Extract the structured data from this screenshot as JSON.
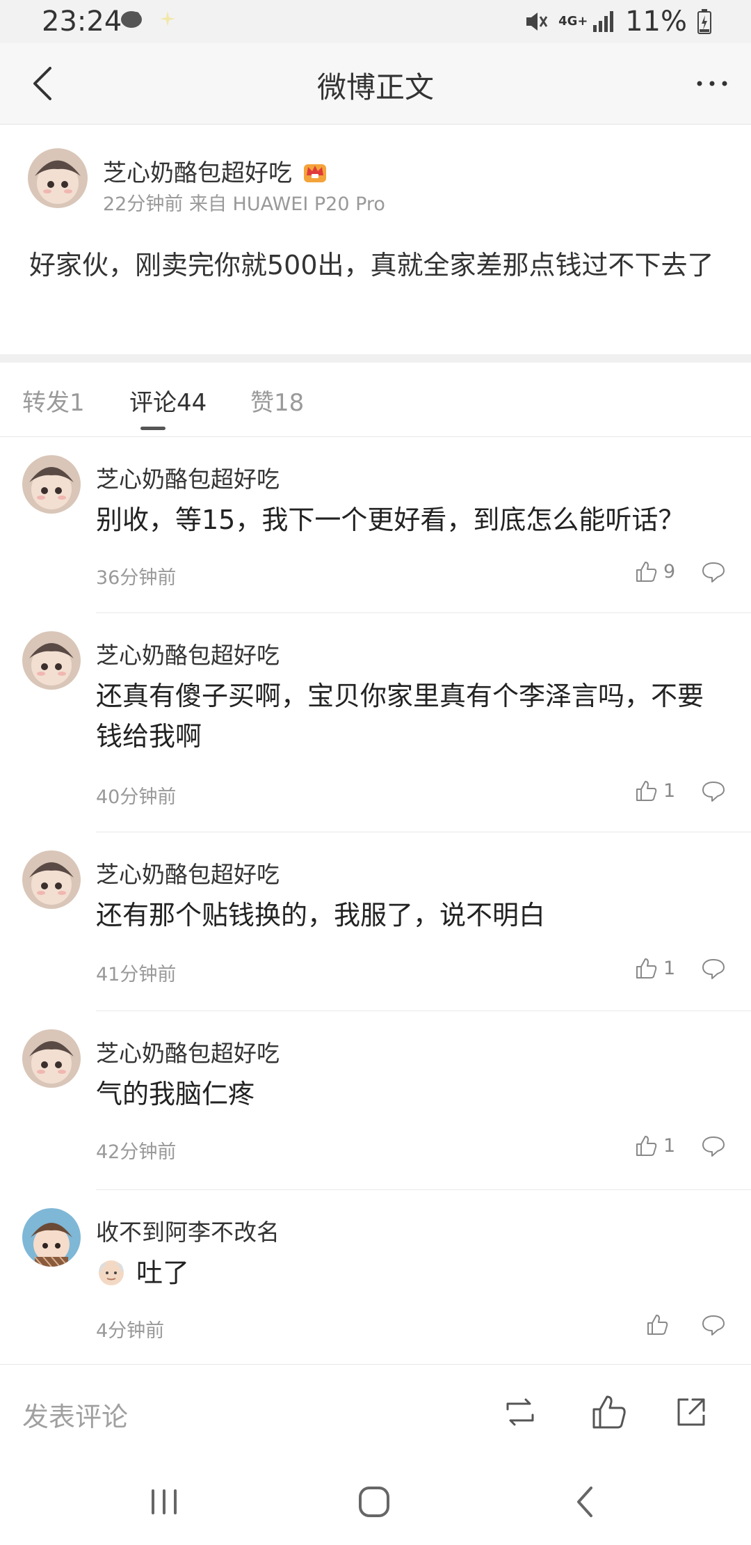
{
  "status_bar": {
    "time": "23:24",
    "battery": "11%",
    "network": "4G+",
    "icons": [
      "weibo-bird-icon",
      "sparkle-icon",
      "mute-icon",
      "signal-icon",
      "battery-icon"
    ]
  },
  "nav": {
    "title": "微博正文",
    "back_icon": "chevron-left-icon",
    "more_icon": "more-dots-icon"
  },
  "post": {
    "author": "芝心奶酪包超好吃",
    "badge_icon": "crown-vip-icon",
    "meta": "22分钟前  来自 HUAWEI P20 Pro",
    "body": "好家伙，刚卖完你就500出，真就全家差那点钱过不下去了"
  },
  "tabs": [
    {
      "label": "转发1",
      "active": false
    },
    {
      "label": "评论44",
      "active": true
    },
    {
      "label": "赞18",
      "active": false
    }
  ],
  "comments": [
    {
      "name": "芝心奶酪包超好吃",
      "text": "别收，等15，我下一个更好看，到底怎么能听话？",
      "time": "36分钟前",
      "likes": "9"
    },
    {
      "name": "芝心奶酪包超好吃",
      "text": "还真有傻子买啊，宝贝你家里真有个李泽言吗，不要钱给我啊",
      "time": "40分钟前",
      "likes": "1"
    },
    {
      "name": "芝心奶酪包超好吃",
      "text": "还有那个贴钱换的，我服了，说不明白",
      "time": "41分钟前",
      "likes": "1"
    },
    {
      "name": "芝心奶酪包超好吃",
      "text": "气的我脑仁疼",
      "time": "42分钟前",
      "likes": "1"
    },
    {
      "name": "收不到阿李不改名",
      "text": "吐了",
      "time": "4分钟前",
      "likes": ""
    }
  ],
  "bottom_bar": {
    "placeholder": "发表评论",
    "icons": [
      "repost-icon",
      "like-icon",
      "share-icon"
    ]
  },
  "colors": {
    "text_primary": "#333333",
    "text_secondary": "#999999",
    "divider": "#e8e8e8",
    "nav_bg": "#f7f7f7"
  }
}
